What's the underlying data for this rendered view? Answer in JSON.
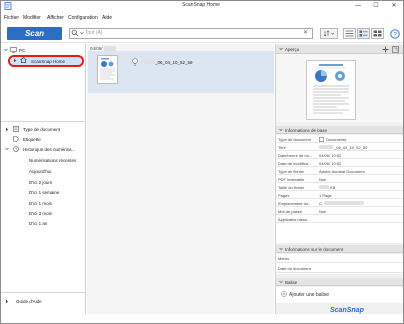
{
  "window": {
    "title": "ScanSnap Home"
  },
  "window_controls": {
    "minimize": "—",
    "maximize": "☐",
    "close": "✕"
  },
  "menu": [
    "Fichier",
    "Modifier",
    "Afficher",
    "Configuration",
    "Aide"
  ],
  "toolbar": {
    "scan_label": "Scan",
    "search_placeholder": "Tout (A)"
  },
  "sidebar": {
    "pc_label": "PC",
    "scansnap_home_label": "ScanSnap Home",
    "groups": [
      {
        "label": "Type de document"
      },
      {
        "label": "Etiquette"
      },
      {
        "label": "Historique des numérisa..."
      }
    ],
    "history_items": [
      "Numérisations récentes",
      "Aujourd'hui",
      "D'ici 2 jours",
      "D'ici 1 semaine",
      "D'ici 1 mois",
      "D'ici 3 mois",
      "D'ici 1 an"
    ],
    "help_label": "Guide d'Aide"
  },
  "list": {
    "date_header": "04/06/",
    "items": [
      {
        "name_suffix": "_06_04_10_52_59"
      }
    ]
  },
  "preview": {
    "header": "Aperçu"
  },
  "basic_info": {
    "header": "Informations de base",
    "rows": [
      {
        "key": "Type de document",
        "value": "Documents"
      },
      {
        "key": "Titre",
        "value": "_06_04_10_52_59"
      },
      {
        "key": "Date/heure de nu...",
        "value": "04/06/      10:52"
      },
      {
        "key": "Date de modifica...",
        "value": "04/06/      10:52"
      },
      {
        "key": "Type de fichier",
        "value": "Adobe Acrobat Document"
      },
      {
        "key": "PDF indexable",
        "value": "Non"
      },
      {
        "key": "Taille du fichier",
        "value": "KB"
      },
      {
        "key": "Pages",
        "value": "1 Page"
      },
      {
        "key": "Emplacement du...",
        "value": "C:"
      },
      {
        "key": "Mot de passe",
        "value": "Non"
      },
      {
        "key": "Application asso...",
        "value": ""
      }
    ]
  },
  "doc_info": {
    "header": "Informations sur le document",
    "rows": [
      {
        "key": "Mémo",
        "value": ""
      },
      {
        "key": "Date du document",
        "value": ""
      }
    ]
  },
  "tags": {
    "header": "Balise",
    "add_label": "Ajouter une balise"
  },
  "footer": {
    "brand": "ScanSnap"
  },
  "colors": {
    "accent": "#2a6fc4",
    "highlight_ring": "#e31c1c",
    "selection": "#dbe6f2"
  }
}
